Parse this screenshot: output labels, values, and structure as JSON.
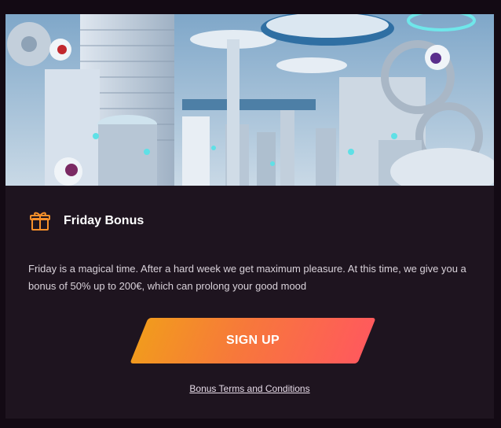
{
  "banner": {
    "alt_icon": "futuristic-city-illustration"
  },
  "promo": {
    "icon": "gift-icon",
    "title": "Friday Bonus",
    "description": "Friday is a magical time. After a hard week we get maximum pleasure. At this time, we give you a bonus of 50% up to 200€, which can prolong your good mood",
    "cta_label": "SIGN UP",
    "terms_link": "Bonus Terms and Conditions"
  },
  "colors": {
    "background": "#130a14",
    "card": "#1e141f",
    "accent_orange": "#f29a1e",
    "accent_red": "#ff5a5c"
  }
}
